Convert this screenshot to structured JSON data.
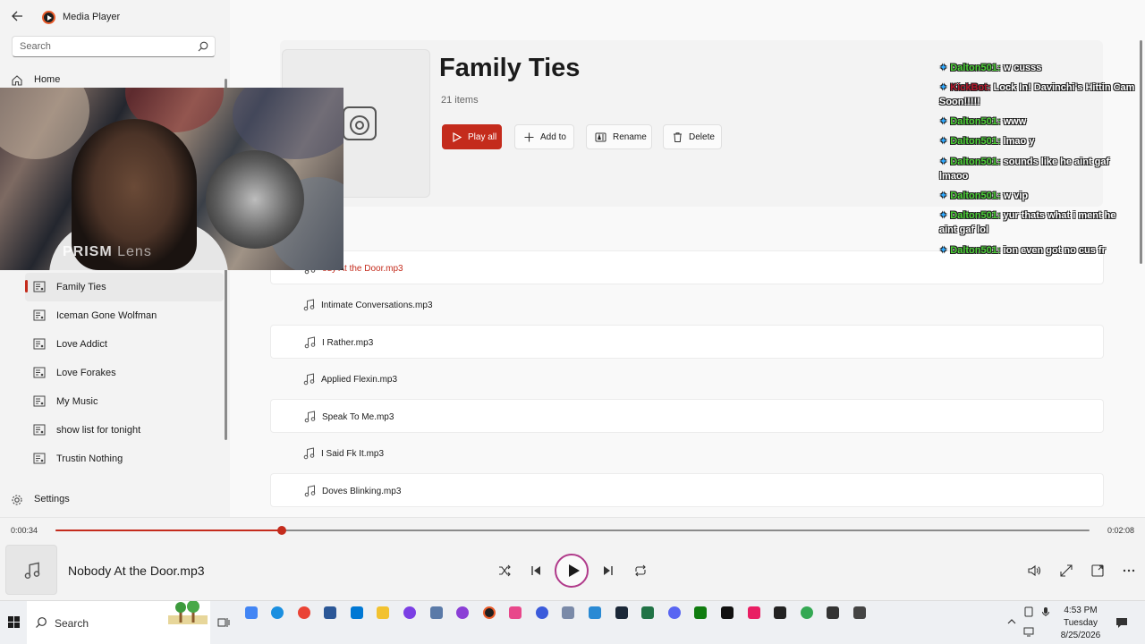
{
  "window": {
    "title": "Media Player",
    "controls": [
      "minimize",
      "restore",
      "close"
    ]
  },
  "sidebar": {
    "search_placeholder": "Search",
    "home_label": "Home",
    "settings_label": "Settings",
    "playlists": [
      {
        "label": "Family Ties",
        "active": true
      },
      {
        "label": "Iceman Gone Wolfman"
      },
      {
        "label": "Love Addict"
      },
      {
        "label": "Love Forakes"
      },
      {
        "label": "My Music"
      },
      {
        "label": "show list  for tonight"
      },
      {
        "label": "Trustin Nothing"
      }
    ]
  },
  "playlist": {
    "title": "Family Ties",
    "count_label": "21 items",
    "buttons": {
      "play_all": "Play all",
      "add_to": "Add to",
      "rename": "Rename",
      "delete": "Delete"
    },
    "tracks": [
      {
        "name": "ody At the Door.mp3",
        "playing": true
      },
      {
        "name": "Intimate Conversations.mp3"
      },
      {
        "name": "I Rather.mp3"
      },
      {
        "name": "Applied Flexin.mp3"
      },
      {
        "name": "Speak To Me.mp3"
      },
      {
        "name": "I Said Fk It.mp3"
      },
      {
        "name": "Doves Blinking.mp3"
      }
    ]
  },
  "webcam": {
    "watermark_main": "PRISM",
    "watermark_sub": "Lens"
  },
  "chat": {
    "messages": [
      {
        "user": "Dalton501:",
        "text": "w cusss"
      },
      {
        "user": "KickBot:",
        "text": "Lock In! Davinchi's Hittin Cam Soon!!!!!",
        "bot": true
      },
      {
        "user": "Dalton501:",
        "text": "www"
      },
      {
        "user": "Dalton501:",
        "text": "lmao y"
      },
      {
        "user": "Dalton501:",
        "text": "sounds like he aint gaf lmaoo"
      },
      {
        "user": "Dalton501:",
        "text": "w vip"
      },
      {
        "user": "Dalton501:",
        "text": "yur thats what i ment he aint gaf lol"
      },
      {
        "user": "Dalton501:",
        "text": "ion even got no cus fr"
      }
    ]
  },
  "player": {
    "current_time": "0:00:34",
    "total_time": "0:02:08",
    "progress": 0.219,
    "now_playing": "Nobody At the Door.mp3"
  },
  "taskbar": {
    "search_placeholder": "Search",
    "time": "4:53 PM",
    "day": "Tuesday",
    "date": "8/25/2026"
  },
  "colors": {
    "accent": "#c42b1c",
    "chat_user": "#4cd137",
    "chat_bot": "#b5162b",
    "play_ring": "#b03a8a"
  }
}
